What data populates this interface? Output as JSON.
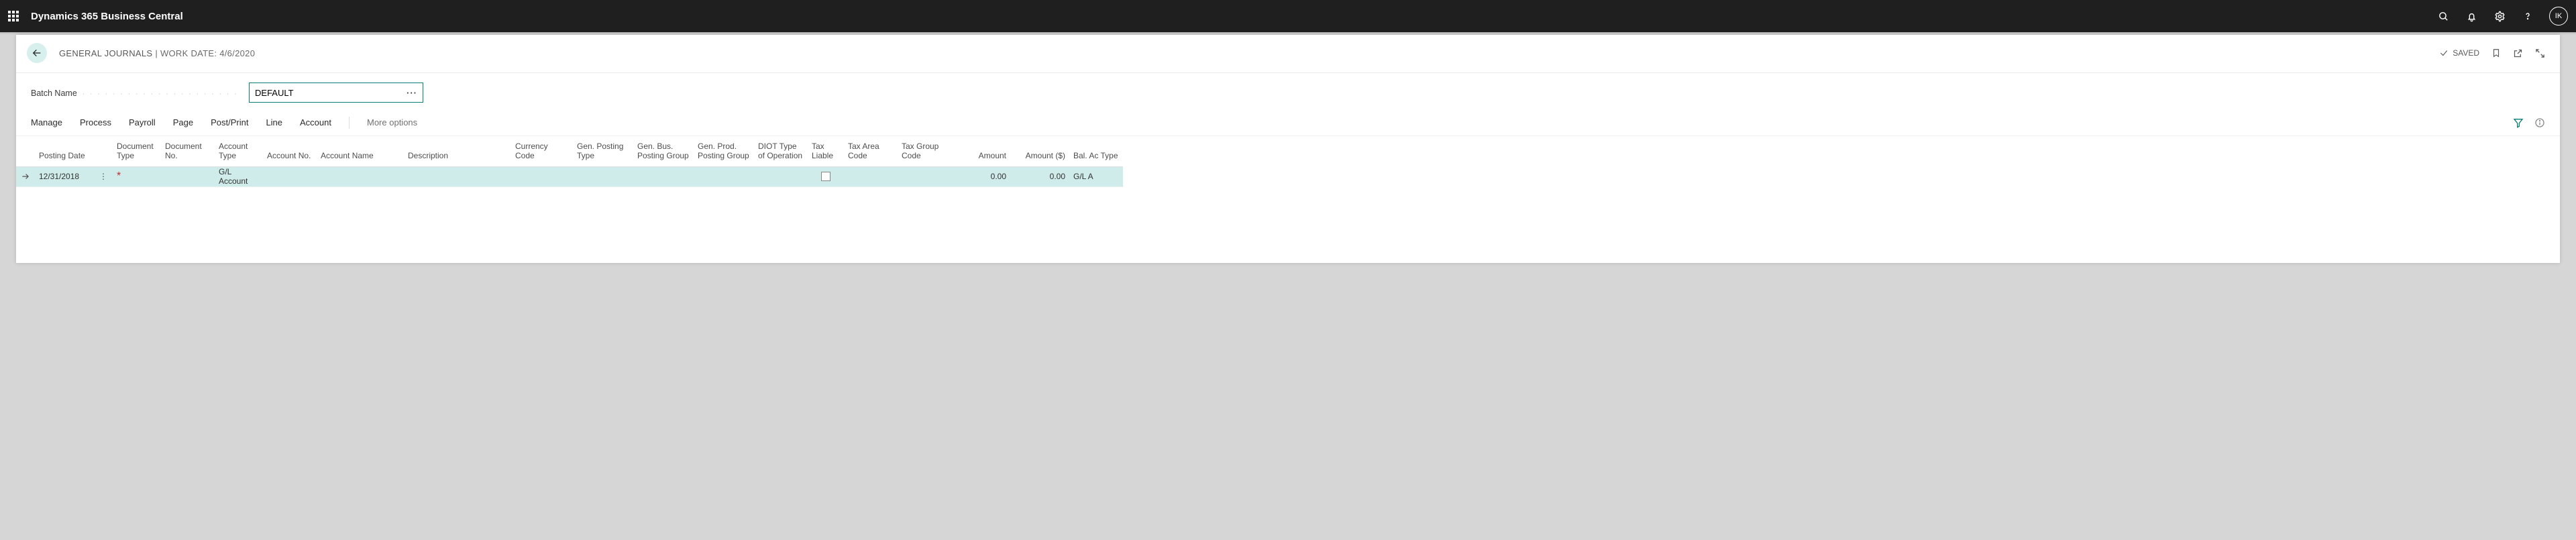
{
  "topbar": {
    "app_title": "Dynamics 365 Business Central",
    "avatar_initials": "IK"
  },
  "header": {
    "crumb_main": "GENERAL JOURNALS",
    "crumb_sep": " | ",
    "crumb_sub": "WORK DATE: 4/6/2020",
    "saved_label": "SAVED"
  },
  "batch": {
    "label": "Batch Name",
    "value": "DEFAULT"
  },
  "toolbar": {
    "tabs": [
      "Manage",
      "Process",
      "Payroll",
      "Page",
      "Post/Print",
      "Line",
      "Account"
    ],
    "more": "More options"
  },
  "columns": [
    "",
    "Posting Date",
    "",
    "Document Type",
    "Document No.",
    "Account Type",
    "Account No.",
    "Account Name",
    "Description",
    "Currency Code",
    "Gen. Posting Type",
    "Gen. Bus. Posting Group",
    "Gen. Prod. Posting Group",
    "DIOT Type of Operation",
    "Tax Liable",
    "Tax Area Code",
    "Tax Group Code",
    "Amount",
    "Amount ($)",
    "Bal. Ac Type"
  ],
  "row": {
    "posting_date": "12/31/2018",
    "document_type": "",
    "document_no": "",
    "account_type": "G/L Account",
    "account_no": "",
    "account_name": "",
    "description": "",
    "currency_code": "",
    "gen_posting_type": "",
    "gen_bus_pg": "",
    "gen_prod_pg": "",
    "diot": "",
    "tax_liable": false,
    "tax_area": "",
    "tax_group": "",
    "amount": "0.00",
    "amount_usd": "0.00",
    "bal_type": "G/L A"
  }
}
